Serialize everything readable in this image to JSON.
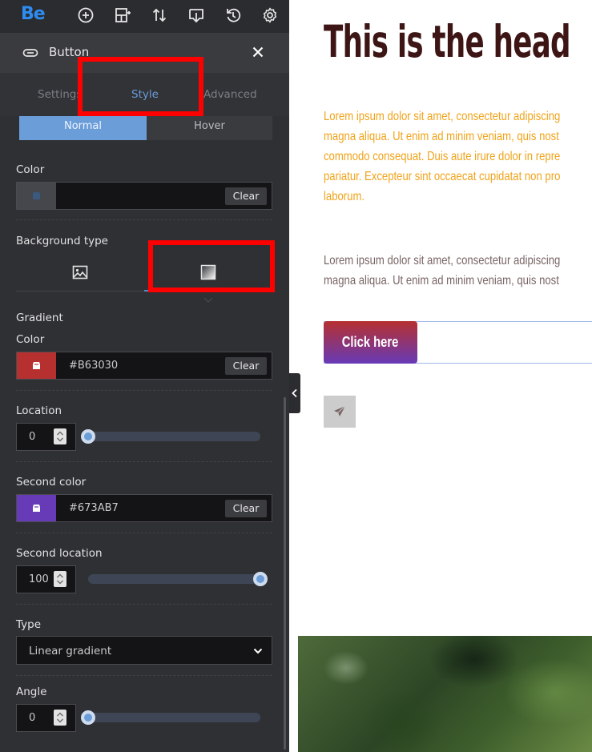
{
  "app": {
    "logo_text": "Be"
  },
  "toolbar": {
    "icons": [
      "add-circle-icon",
      "add-section-icon",
      "sort-icon",
      "import-export-icon",
      "history-icon",
      "settings-icon"
    ]
  },
  "panel": {
    "title": "Button",
    "title_icon": "button-element-icon",
    "tabs": [
      {
        "label": "Settings",
        "active": false
      },
      {
        "label": "Style",
        "active": true
      },
      {
        "label": "Advanced",
        "active": false
      }
    ],
    "state_toggle": {
      "normal": "Normal",
      "hover": "Hover",
      "active": "Normal"
    },
    "color": {
      "label": "Color",
      "value": "",
      "clear_label": "Clear"
    },
    "background_type": {
      "label": "Background type",
      "options": [
        "image-icon",
        "gradient-icon"
      ],
      "selected": "gradient"
    },
    "gradient": {
      "section_label": "Gradient",
      "color": {
        "label": "Color",
        "value": "#B63030",
        "swatch": "#B63030",
        "clear_label": "Clear"
      },
      "location": {
        "label": "Location",
        "value": "0",
        "fraction": 0
      },
      "second_color": {
        "label": "Second color",
        "value": "#673AB7",
        "swatch": "#673AB7",
        "clear_label": "Clear"
      },
      "second_location": {
        "label": "Second location",
        "value": "100",
        "fraction": 1
      },
      "type": {
        "label": "Type",
        "value": "Linear gradient"
      },
      "angle": {
        "label": "Angle",
        "value": "0",
        "fraction": 0
      }
    }
  },
  "preview": {
    "heading": "This is the head",
    "paragraph1_lines": [
      "Lorem ipsum dolor sit amet, consectetur adipiscing",
      "magna aliqua. Ut enim ad minim veniam, quis nost",
      "commodo consequat. Duis aute irure dolor in repre",
      "pariatur. Excepteur sint occaecat cupidatat non pro",
      "laborum."
    ],
    "paragraph2_lines": [
      "Lorem ipsum dolor sit amet, consectetur adipiscing",
      "magna aliqua. Ut enim ad minim veniam, quis nost"
    ],
    "button_label": "Click here",
    "icon_box": "send-icon"
  },
  "colors": {
    "accent": "#6B9ED9",
    "highlight": "#FF0000",
    "heading": "#3D1515",
    "paragraph1": "#F0A31A",
    "paragraph2": "#7A6565",
    "gradient_start": "#B63030",
    "gradient_end": "#673AB7"
  }
}
